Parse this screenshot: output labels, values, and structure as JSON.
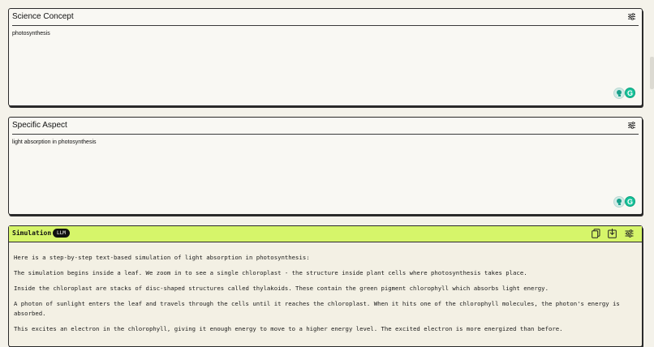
{
  "fields": [
    {
      "title": "Science Concept",
      "value": "photosynthesis",
      "settings_icon": "sliders-icon",
      "widgets": [
        "lightbulb-icon",
        "grammarly-icon"
      ]
    },
    {
      "title": "Specific Aspect",
      "value": "light absorption in photosynthesis",
      "settings_icon": "sliders-icon",
      "widgets": [
        "lightbulb-icon",
        "grammarly-icon"
      ]
    }
  ],
  "output": {
    "title": "Simulation",
    "badge": "LLM",
    "icons": [
      "copy-icon",
      "download-icon",
      "sliders-icon"
    ],
    "header_color": "#d6f56a",
    "paragraphs": [
      "Here is a step-by-step text-based simulation of light absorption in photosynthesis:",
      "The simulation begins inside a leaf. We zoom in to see a single chloroplast - the structure inside plant cells where photosynthesis takes place.",
      "Inside the chloroplast are stacks of disc-shaped structures called thylakoids. These contain the green pigment chlorophyll which absorbs light energy.",
      "A photon of sunlight enters the leaf and travels through the cells until it reaches the chloroplast. When it hits one of the chlorophyll molecules, the photon's energy is absorbed.",
      "This excites an electron in the chlorophyll, giving it enough energy to move to a higher energy level. The excited electron is more energized than before."
    ]
  },
  "grammarly_letter": "G"
}
